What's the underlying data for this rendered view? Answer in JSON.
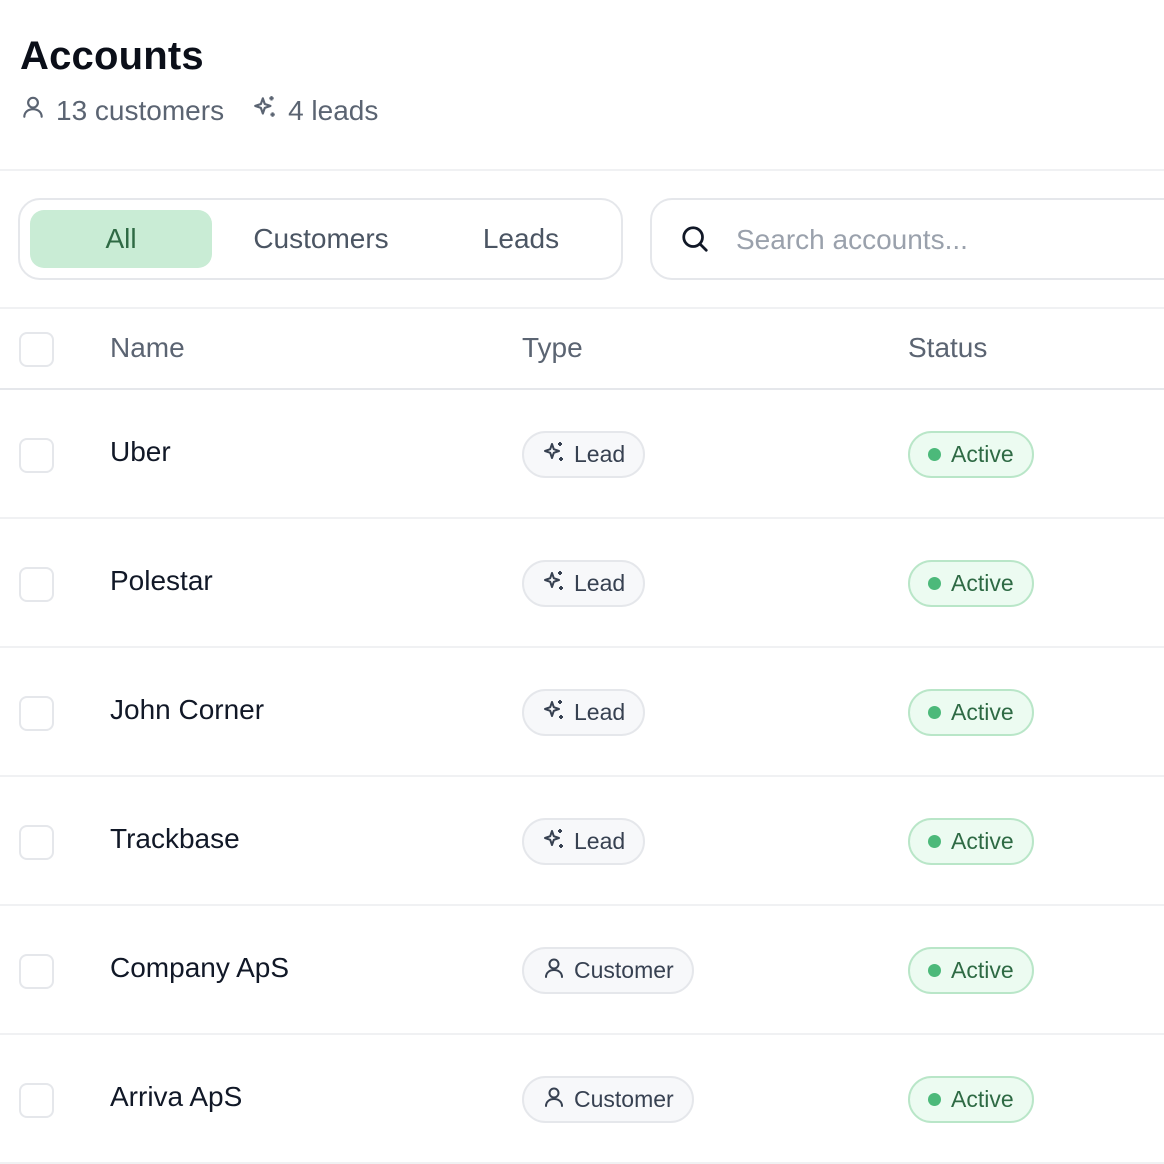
{
  "header": {
    "title": "Accounts",
    "customers_stat": "13 customers",
    "leads_stat": "4 leads"
  },
  "filters": {
    "all": "All",
    "customers": "Customers",
    "leads": "Leads",
    "selected": "All"
  },
  "search": {
    "placeholder": "Search accounts...",
    "value": ""
  },
  "table": {
    "columns": [
      "Name",
      "Type",
      "Status"
    ],
    "rows": [
      {
        "name": "Uber",
        "type": "Lead",
        "type_icon": "sparkles-icon",
        "status": "Active"
      },
      {
        "name": "Polestar",
        "type": "Lead",
        "type_icon": "sparkles-icon",
        "status": "Active"
      },
      {
        "name": "John Corner",
        "type": "Lead",
        "type_icon": "sparkles-icon",
        "status": "Active"
      },
      {
        "name": "Trackbase",
        "type": "Lead",
        "type_icon": "sparkles-icon",
        "status": "Active"
      },
      {
        "name": "Company ApS",
        "type": "Customer",
        "type_icon": "user-icon",
        "status": "Active"
      },
      {
        "name": "Arriva ApS",
        "type": "Customer",
        "type_icon": "user-icon",
        "status": "Active"
      }
    ]
  },
  "colors": {
    "accent_selected_bg": "#c9ecd5",
    "accent_selected_text": "#2e6a44",
    "status_active_dot": "#4cb97a"
  }
}
